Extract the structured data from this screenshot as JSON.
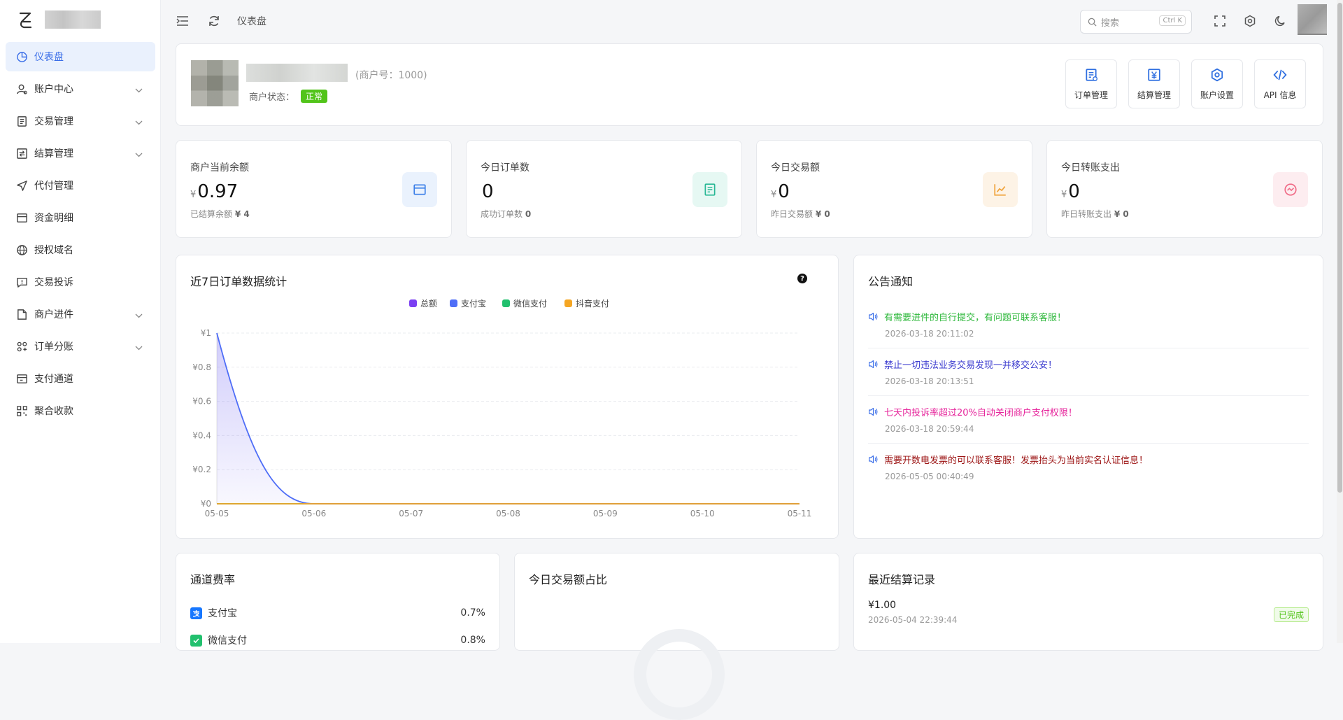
{
  "sidebar": {
    "items": [
      {
        "label": "仪表盘",
        "icon": "pie-chart-icon",
        "active": true
      },
      {
        "label": "账户中心",
        "icon": "user-icon",
        "expandable": true
      },
      {
        "label": "交易管理",
        "icon": "document-icon",
        "expandable": true
      },
      {
        "label": "结算管理",
        "icon": "settlement-icon",
        "expandable": true
      },
      {
        "label": "代付管理",
        "icon": "send-icon"
      },
      {
        "label": "资金明细",
        "icon": "wallet-icon"
      },
      {
        "label": "授权域名",
        "icon": "globe-icon"
      },
      {
        "label": "交易投诉",
        "icon": "complaint-icon"
      },
      {
        "label": "商户进件",
        "icon": "file-plus-icon",
        "expandable": true
      },
      {
        "label": "订单分账",
        "icon": "split-icon",
        "expandable": true
      },
      {
        "label": "支付通道",
        "icon": "channel-icon"
      },
      {
        "label": "聚合收款",
        "icon": "qrcode-icon"
      }
    ]
  },
  "topbar": {
    "breadcrumb": "仪表盘",
    "search_placeholder": "搜索",
    "search_shortcut": "Ctrl K"
  },
  "merchant": {
    "id_text": "(商户号：1000)",
    "status_label": "商户状态：",
    "status_value": "正常"
  },
  "quick_actions": [
    {
      "label": "订单管理",
      "icon": "order-doc-icon"
    },
    {
      "label": "结算管理",
      "icon": "yen-settle-icon"
    },
    {
      "label": "账户设置",
      "icon": "gear-icon"
    },
    {
      "label": "API 信息",
      "icon": "code-icon"
    }
  ],
  "stats": [
    {
      "title": "商户当前余额",
      "currency": "¥",
      "value": "0.97",
      "sub_label": "已结算余额",
      "sub_value": "¥ 4",
      "icon": "wallet-icon",
      "color": "#3a7ee8",
      "bg": "#eaf2fd"
    },
    {
      "title": "今日订单数",
      "currency": "",
      "value": "0",
      "sub_label": "成功订单数",
      "sub_value": "0",
      "icon": "receipt-icon",
      "color": "#28b895",
      "bg": "#e6f8f3"
    },
    {
      "title": "今日交易额",
      "currency": "¥",
      "value": "0",
      "sub_label": "昨日交易额",
      "sub_value": "¥ 0",
      "icon": "trend-up-icon",
      "color": "#f0a238",
      "bg": "#fdf3e6"
    },
    {
      "title": "今日转账支出",
      "currency": "¥",
      "value": "0",
      "sub_label": "昨日转账支出",
      "sub_value": "¥ 0",
      "icon": "transfer-icon",
      "color": "#f06a86",
      "bg": "#fdedf0"
    }
  ],
  "chart_section": {
    "title": "近7日订单数据统计",
    "help_icon": "question-circle-icon"
  },
  "chart_data": {
    "type": "area",
    "title": "近7日订单数据统计",
    "categories": [
      "05-05",
      "05-06",
      "05-07",
      "05-08",
      "05-09",
      "05-10",
      "05-11"
    ],
    "y_tick_labels": [
      "¥0",
      "¥0.2",
      "¥0.4",
      "¥0.6",
      "¥0.8",
      "¥1"
    ],
    "ylim": [
      0,
      1
    ],
    "legend_position": "top",
    "grid": true,
    "series": [
      {
        "name": "总额",
        "color": "#7b3ff2",
        "values": [
          0,
          0,
          0,
          0,
          0,
          0,
          0
        ]
      },
      {
        "name": "支付宝",
        "color": "#4f6ef7",
        "values": [
          1,
          0,
          0,
          0,
          0,
          0,
          0
        ]
      },
      {
        "name": "微信支付",
        "color": "#22c06e",
        "values": [
          0,
          0,
          0,
          0,
          0,
          0,
          0
        ]
      },
      {
        "name": "抖音支付",
        "color": "#f5a623",
        "values": [
          0,
          0,
          0,
          0,
          0,
          0,
          0
        ]
      }
    ]
  },
  "notices": {
    "title": "公告通知",
    "items": [
      {
        "text": "有需要进件的自行提交，有问题可联系客服！",
        "date": "2026-03-18 20:11:02",
        "color": "#2fb83c"
      },
      {
        "text": "禁止一切违法业务交易发现一并移交公安！",
        "date": "2026-03-18 20:13:51",
        "color": "#3b3bcf"
      },
      {
        "text": "七天内投诉率超过20%自动关闭商户支付权限！",
        "date": "2026-03-18 20:59:44",
        "color": "#e6249b"
      },
      {
        "text": "需要开数电发票的可以联系客服！发票抬头为当前实名认证信息！",
        "date": "2026-05-05 00:40:49",
        "color": "#9b1111"
      }
    ]
  },
  "channel_rates": {
    "title": "通道费率",
    "items": [
      {
        "name": "支付宝",
        "rate": "0.7%",
        "icon": "alipay-icon",
        "color": "#1677ff"
      },
      {
        "name": "微信支付",
        "rate": "0.8%",
        "icon": "wechat-pay-icon",
        "color": "#22c06e"
      }
    ]
  },
  "today_ratio": {
    "title": "今日交易额占比"
  },
  "recent_settle": {
    "title": "最近结算记录",
    "items": [
      {
        "amount": "¥1.00",
        "date": "2026-05-04 22:39:44",
        "status": "已完成"
      }
    ]
  }
}
